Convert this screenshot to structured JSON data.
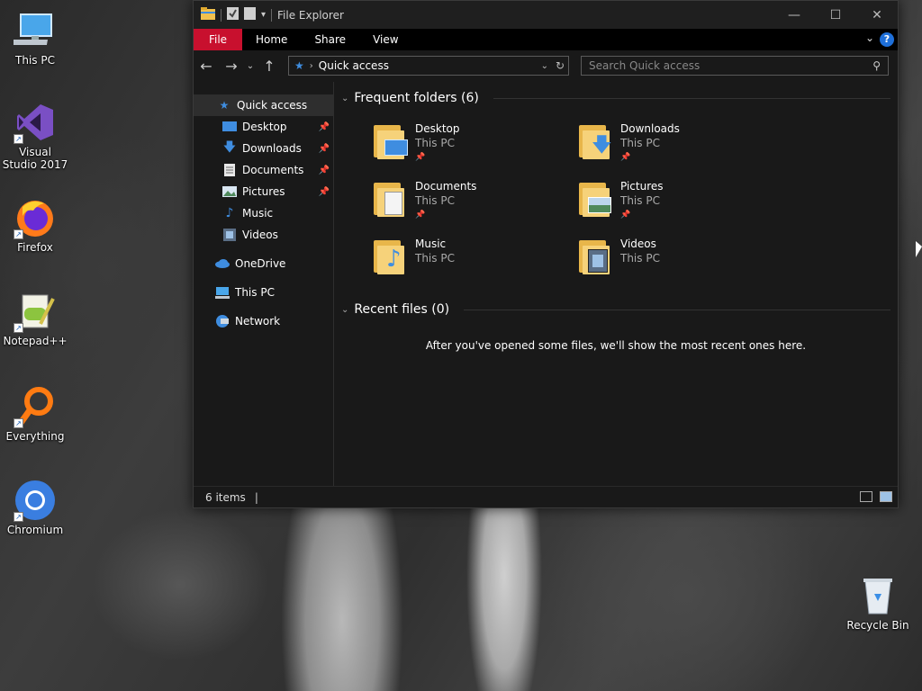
{
  "desktop": {
    "icons": [
      {
        "label": "This PC",
        "icon": "this-pc-icon"
      },
      {
        "label": "Visual Studio 2017",
        "icon": "visual-studio-icon"
      },
      {
        "label": "Firefox",
        "icon": "firefox-icon"
      },
      {
        "label": "Notepad++",
        "icon": "notepadpp-icon"
      },
      {
        "label": "Everything",
        "icon": "everything-icon"
      },
      {
        "label": "Chromium",
        "icon": "chromium-icon"
      },
      {
        "label": "Recycle Bin",
        "icon": "recycle-bin-icon"
      }
    ]
  },
  "window": {
    "title": "File Explorer",
    "ribbon": {
      "file": "File",
      "home": "Home",
      "share": "Share",
      "view": "View",
      "help": "?"
    },
    "address": {
      "path": "Quick access"
    },
    "search": {
      "placeholder": "Search Quick access"
    },
    "nav": {
      "quick_access": "Quick access",
      "items": [
        "Desktop",
        "Downloads",
        "Documents",
        "Pictures",
        "Music",
        "Videos"
      ],
      "onedrive": "OneDrive",
      "this_pc": "This PC",
      "network": "Network"
    },
    "frequent": {
      "header": "Frequent folders (6)",
      "folders": [
        {
          "name": "Desktop",
          "location": "This PC"
        },
        {
          "name": "Downloads",
          "location": "This PC"
        },
        {
          "name": "Documents",
          "location": "This PC"
        },
        {
          "name": "Pictures",
          "location": "This PC"
        },
        {
          "name": "Music",
          "location": "This PC"
        },
        {
          "name": "Videos",
          "location": "This PC"
        }
      ]
    },
    "recent": {
      "header": "Recent files (0)",
      "empty_message": "After you've opened some files, we'll show the most recent ones here."
    },
    "status": {
      "items": "6 items"
    }
  },
  "colors": {
    "accent": "#c8102e",
    "folder": "#f6d27a",
    "selection": "#2e2e2e"
  }
}
